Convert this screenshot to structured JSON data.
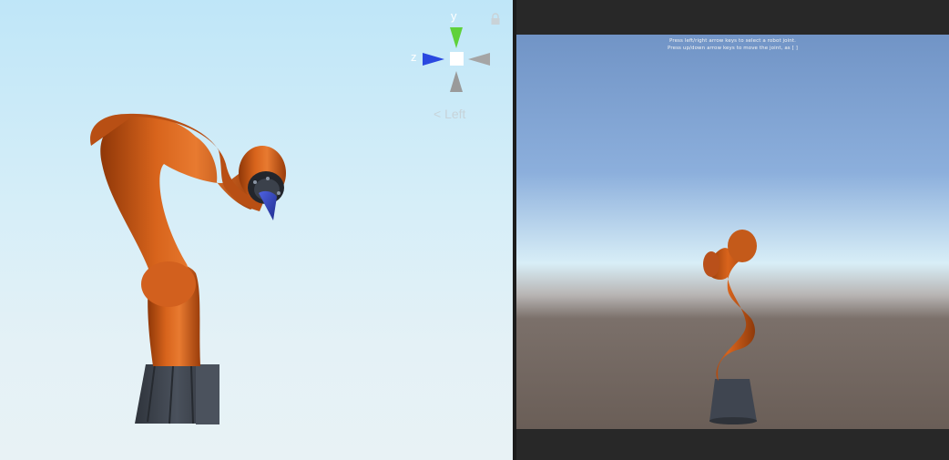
{
  "scene_view": {
    "gizmo": {
      "axis_y": "y",
      "axis_z": "z",
      "view_label": "Left",
      "view_arrow": "<",
      "colors": {
        "y": "#5fd13a",
        "z": "#2a48e0",
        "x": "#9a9a9a",
        "center": "#ffffff"
      }
    },
    "icons": [
      "lock-icon",
      "view-gizmo"
    ]
  },
  "game_view": {
    "instructions": [
      "Press left/right arrow keys to select a robot joint.",
      "Press up/down arrow keys to move the joint, as [ ]"
    ]
  },
  "colors": {
    "robot_orange": "#c65a1a",
    "robot_base": "#3f4550",
    "tool_blue": "#2a3fb8"
  }
}
